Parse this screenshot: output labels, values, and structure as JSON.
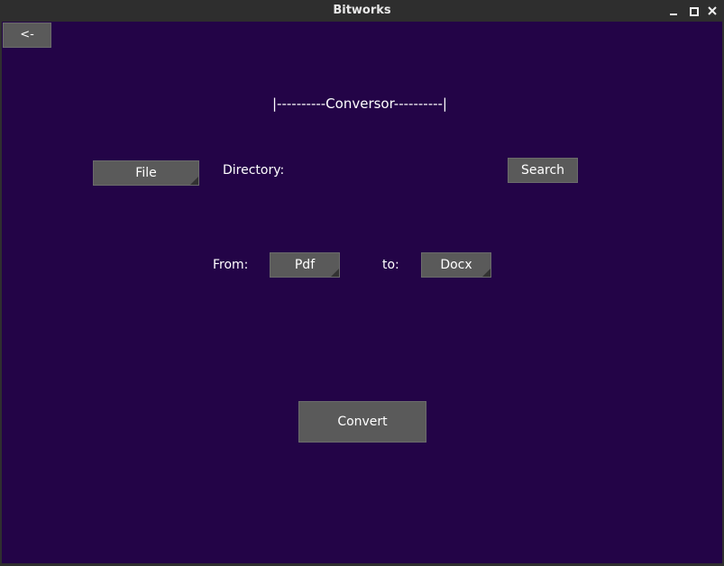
{
  "window": {
    "title": "Bitworks",
    "controls": {
      "minimize": "minimize-icon",
      "maximize": "maximize-icon",
      "close": "close-icon"
    }
  },
  "colors": {
    "background": "#230447",
    "button": "#5a5a5a",
    "text": "#ffffff"
  },
  "nav": {
    "back_label": "<-"
  },
  "main": {
    "heading": "|----------Conversor----------|",
    "file_button": "File",
    "directory_label": "Directory:",
    "directory_value": "",
    "search_button": "Search",
    "from_label": "From:",
    "from_value": "Pdf",
    "to_label": "to:",
    "to_value": "Docx",
    "convert_button": "Convert"
  }
}
